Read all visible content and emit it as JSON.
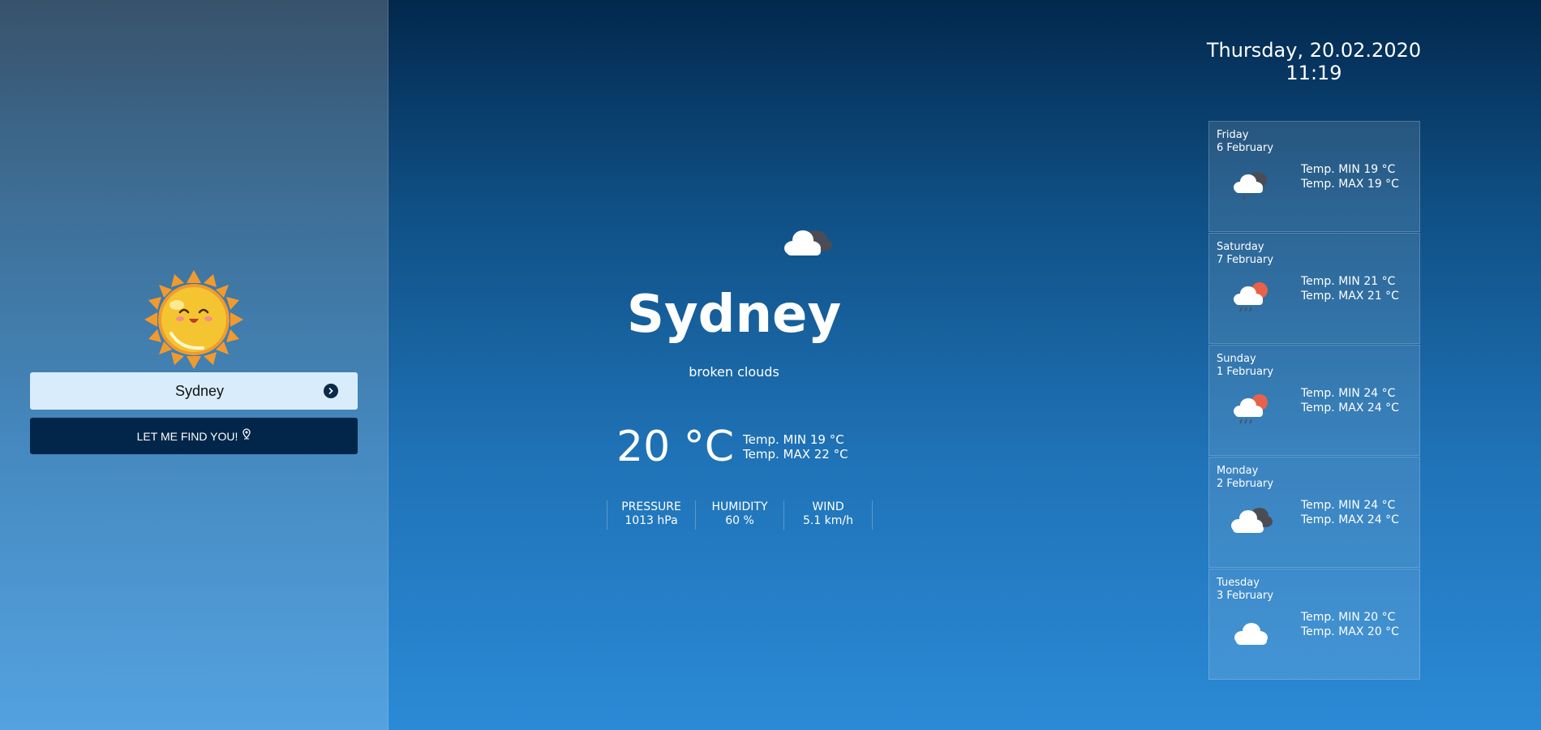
{
  "search": {
    "value": "Sydney",
    "find_label": "LET ME FIND YOU!"
  },
  "current": {
    "city": "Sydney",
    "description": "broken clouds",
    "temperature": "20 °C",
    "temp_min": "Temp. MIN 19 °C",
    "temp_max": "Temp. MAX 22 °C",
    "icon": "broken-clouds-icon",
    "stats": [
      {
        "label": "PRESSURE",
        "value": "1013 hPa"
      },
      {
        "label": "HUMIDITY",
        "value": "60 %"
      },
      {
        "label": "WIND",
        "value": "5.1 km/h"
      }
    ]
  },
  "datetime": {
    "date": "Thursday, 20.02.2020",
    "time": "11:19"
  },
  "forecast": [
    {
      "day": "Friday",
      "date": "6 February",
      "min": "Temp. MIN 19 °C",
      "max": "Temp. MAX 19 °C",
      "icon": "cloud-rain-icon"
    },
    {
      "day": "Saturday",
      "date": "7 February",
      "min": "Temp. MIN 21 °C",
      "max": "Temp. MAX 21 °C",
      "icon": "sun-cloud-rain-icon"
    },
    {
      "day": "Sunday",
      "date": "1 February",
      "min": "Temp. MIN 24 °C",
      "max": "Temp. MAX 24 °C",
      "icon": "sun-cloud-rain-icon"
    },
    {
      "day": "Monday",
      "date": "2 February",
      "min": "Temp. MIN 24 °C",
      "max": "Temp. MAX 24 °C",
      "icon": "broken-clouds-icon"
    },
    {
      "day": "Tuesday",
      "date": "3 February",
      "min": "Temp. MIN 20 °C",
      "max": "Temp. MAX 20 °C",
      "icon": "cloud-icon"
    }
  ],
  "colors": {
    "accent_dark": "#02264a",
    "input_bg": "#d9ecfb",
    "sun": "#f5c431",
    "sun_rays": "#f19a2e"
  }
}
